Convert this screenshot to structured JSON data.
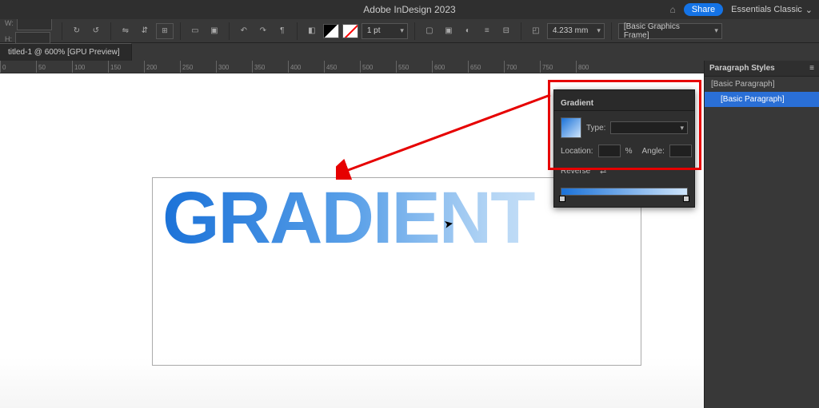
{
  "app": {
    "title": "Adobe InDesign 2023"
  },
  "title_right": {
    "share": "Share",
    "workspace": "Essentials Classic"
  },
  "control": {
    "w_label": "W:",
    "h_label": "H:",
    "w_value": "",
    "h_value": "",
    "stroke_weight": "1 pt",
    "gap_value": "4.233 mm",
    "frame_style": "[Basic Graphics Frame]"
  },
  "document": {
    "tab": "titled-1 @ 600% [GPU Preview]"
  },
  "ruler": {
    "marks": [
      "0",
      "50",
      "100",
      "150",
      "200",
      "250",
      "300",
      "350",
      "400",
      "450",
      "500",
      "550",
      "600",
      "650",
      "700",
      "750",
      "800"
    ]
  },
  "canvas": {
    "text": "GRADIENT"
  },
  "gradient_panel": {
    "title": "Gradient",
    "type_label": "Type:",
    "type_value": "",
    "location_label": "Location:",
    "location_unit": "%",
    "angle_label": "Angle:",
    "reverse_label": "Reverse"
  },
  "paragraph_styles": {
    "title": "Paragraph Styles",
    "none": "[Basic Paragraph]",
    "selected": "[Basic Paragraph]"
  }
}
